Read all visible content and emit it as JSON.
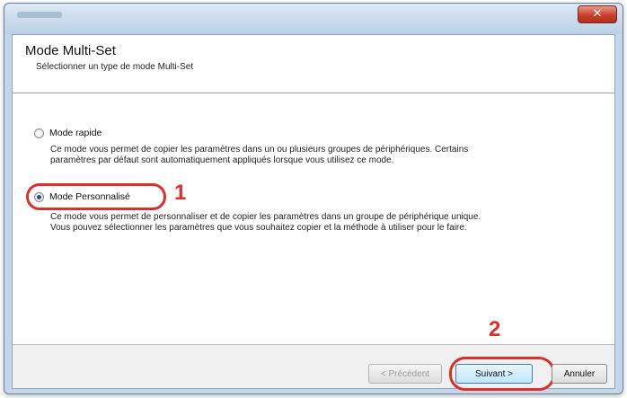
{
  "window": {
    "close_symbol": "✕"
  },
  "header": {
    "title": "Mode Multi-Set",
    "subtitle": "Sélectionner un type de mode Multi-Set"
  },
  "options": [
    {
      "label": "Mode rapide",
      "selected": false,
      "description_line1": "Ce mode vous permet de copier les paramètres dans un ou plusieurs groupes de périphériques. Certains",
      "description_line2": "paramètres par défaut sont automatiquement appliqués lorsque vous utilisez ce mode."
    },
    {
      "label": "Mode Personnalisé",
      "selected": true,
      "description_line1": "Ce mode vous permet de personnaliser et de copier les paramètres dans un groupe de périphérique unique.",
      "description_line2": "Vous pouvez sélectionner les paramètres que vous souhaitez copier et la méthode à utiliser pour le faire."
    }
  ],
  "annotations": {
    "step1": "1",
    "step2": "2",
    "highlight_color": "#d9302a"
  },
  "buttons": {
    "back": "< Précédent",
    "next": "Suivant >",
    "cancel": "Annuler"
  },
  "colors": {
    "titlebar": "#c3d6ea",
    "close_button": "#c9402c",
    "radio_dot": "#2a4f8f"
  }
}
